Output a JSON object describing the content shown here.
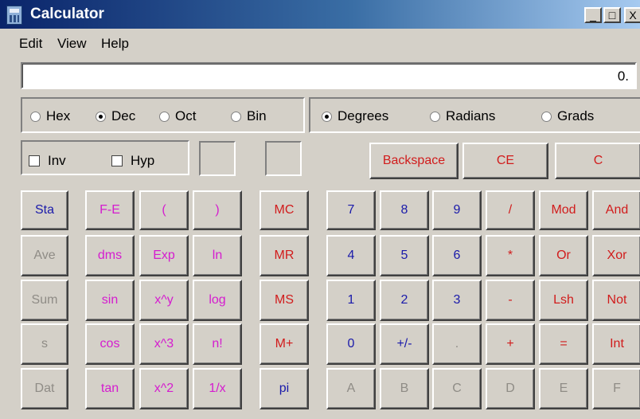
{
  "window": {
    "title": "Calculator",
    "min_label": "_",
    "max_label": "□",
    "close_label": "X"
  },
  "menu": {
    "edit": "Edit",
    "view": "View",
    "help": "Help"
  },
  "display": {
    "value": "0."
  },
  "base": {
    "hex": "Hex",
    "dec": "Dec",
    "oct": "Oct",
    "bin": "Bin",
    "selected": "Dec"
  },
  "angle": {
    "degrees": "Degrees",
    "radians": "Radians",
    "grads": "Grads",
    "selected": "Degrees"
  },
  "options": {
    "inv": "Inv",
    "hyp": "Hyp"
  },
  "keys": {
    "backspace": "Backspace",
    "ce": "CE",
    "c": "C",
    "stat": [
      "Sta",
      "Ave",
      "Sum",
      "s",
      "Dat"
    ],
    "sci1": [
      "F-E",
      "dms",
      "sin",
      "cos",
      "tan"
    ],
    "sci2": [
      "(",
      "Exp",
      "x^y",
      "x^3",
      "x^2"
    ],
    "sci3": [
      ")",
      "ln",
      "log",
      "n!",
      "1/x"
    ],
    "mem": [
      "MC",
      "MR",
      "MS",
      "M+",
      "pi"
    ],
    "num": [
      [
        "7",
        "8",
        "9",
        "/",
        "Mod",
        "And"
      ],
      [
        "4",
        "5",
        "6",
        "*",
        "Or",
        "Xor"
      ],
      [
        "1",
        "2",
        "3",
        "-",
        "Lsh",
        "Not"
      ],
      [
        "0",
        "+/-",
        ".",
        "+",
        "=",
        "Int"
      ],
      [
        "A",
        "B",
        "C",
        "D",
        "E",
        "F"
      ]
    ]
  },
  "colors": {
    "blue": "#1a1aaa",
    "red": "#d11c1c",
    "magenta": "#d51ccf",
    "disabled": "#8f8c86"
  }
}
